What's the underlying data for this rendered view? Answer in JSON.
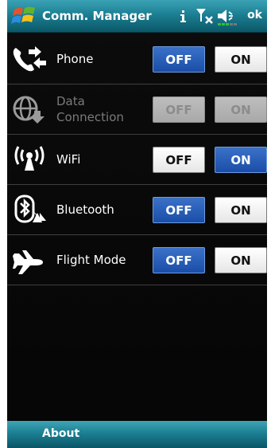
{
  "header": {
    "title": "Comm. Manager",
    "ok_label": "ok",
    "icons": [
      "windows-start-icon",
      "info-icon",
      "signal-off-icon",
      "speaker-muted-icon"
    ]
  },
  "rows": [
    {
      "label_line1": "Phone",
      "label_line2": "",
      "icon": "phone-icon",
      "off": "OFF",
      "on": "ON",
      "state": "off",
      "enabled": true
    },
    {
      "label_line1": "Data",
      "label_line2": "Connection",
      "icon": "data-connection-icon",
      "off": "OFF",
      "on": "ON",
      "state": "none",
      "enabled": false
    },
    {
      "label_line1": "WiFi",
      "label_line2": "",
      "icon": "wifi-icon",
      "off": "OFF",
      "on": "ON",
      "state": "on",
      "enabled": true
    },
    {
      "label_line1": "Bluetooth",
      "label_line2": "",
      "icon": "bluetooth-icon",
      "off": "OFF",
      "on": "ON",
      "state": "off",
      "enabled": true
    },
    {
      "label_line1": "Flight Mode",
      "label_line2": "",
      "icon": "airplane-icon",
      "off": "OFF",
      "on": "ON",
      "state": "off",
      "enabled": true
    }
  ],
  "footer": {
    "about_label": "About"
  },
  "colors": {
    "active_blue": "#1f57b3",
    "bar_teal": "#1c7f93",
    "background": "#080808"
  }
}
